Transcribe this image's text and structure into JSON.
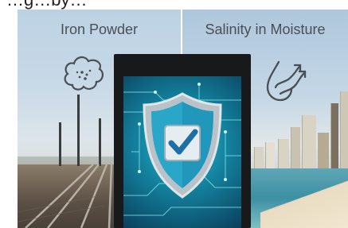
{
  "header": {
    "partial_title": "…g…by…"
  },
  "left_panel": {
    "label": "Iron Powder",
    "icon": "iron-powder-icon"
  },
  "right_panel": {
    "label": "Salinity in Moisture",
    "icon": "moisture-salinity-icon"
  },
  "monitor": {
    "screen_icon": "shield-checkmark-icon"
  },
  "colors": {
    "label_text": "#4a4f55",
    "shield": "#2aa6c9",
    "check": "#1e6fa6",
    "circuit": "#8fe9f5"
  }
}
